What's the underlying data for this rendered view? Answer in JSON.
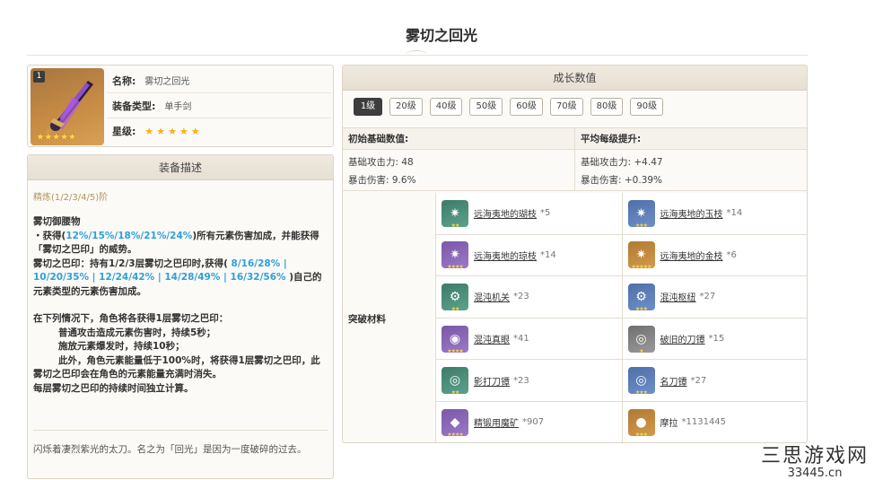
{
  "page": {
    "title": "雾切之回光"
  },
  "info": {
    "refine_badge": "1",
    "name_key": "名称:",
    "name_val": "雾切之回光",
    "type_key": "装备类型:",
    "type_val": "单手剑",
    "star_key": "星级:",
    "stars": "★★★★★",
    "icon_stars": "★★★★★"
  },
  "desc": {
    "header": "装备描述",
    "refine_label": "精炼(1/2/3/4/5)阶",
    "skill_name": "雾切御腰物",
    "line1_a": "・获得(",
    "line1_hl": "12%/15%/18%/21%/24%",
    "line1_b": ")所有元素伤害加成，并能获得「雾切之巴印」的威势。",
    "line2_a": "雾切之巴印：持有1/2/3层雾切之巴印时,获得( ",
    "line2_hl": "8/16/28% | 10/20/35% | 12/24/42% | 14/28/49% | 16/32/56%",
    "line2_b": " )自己的元素类型的元素伤害加成。",
    "line3": "在下列情况下，角色将各获得1层雾切之巴印：",
    "line4": "普通攻击造成元素伤害时，持续5秒；",
    "line5": "施放元素爆发时，持续10秒；",
    "line6": "此外，角色元素能量低于100%时，将获得1层雾切之巴印，此雾切之巴印会在角色的元素能量充满时消失。",
    "line7": "每层雾切之巴印的持续时间独立计算。",
    "lore": "闪烁着凄烈紫光的太刀。名之为「回光」是因为一度破碎的过去。"
  },
  "growth": {
    "header": "成长数值",
    "levels": [
      "1级",
      "20级",
      "40级",
      "50级",
      "60级",
      "70级",
      "80级",
      "90级"
    ],
    "base_head": "初始基础数值:",
    "avg_head": "平均每级提升:",
    "base_atk": "基础攻击力: 48",
    "base_crit": "暴击伤害: 9.6%",
    "avg_atk": "基础攻击力: +4.47",
    "avg_crit": "暴击伤害: +0.39%",
    "mat_label": "突破材料",
    "materials": [
      {
        "name": "远海夷地的瑚枝",
        "count": "*5"
      },
      {
        "name": "远海夷地的玉枝",
        "count": "*14"
      },
      {
        "name": "远海夷地的琼枝",
        "count": "*14"
      },
      {
        "name": "远海夷地的金枝",
        "count": "*6"
      },
      {
        "name": "混沌机关",
        "count": "*23"
      },
      {
        "name": "混沌枢纽",
        "count": "*27"
      },
      {
        "name": "混沌真眼",
        "count": "*41"
      },
      {
        "name": "破旧的刀镡",
        "count": "*15"
      },
      {
        "name": "影打刀镡",
        "count": "*23"
      },
      {
        "name": "名刀镡",
        "count": "*27"
      },
      {
        "name": "精锻用魔矿",
        "count": "*907"
      },
      {
        "name": "摩拉",
        "count": "*1131445"
      }
    ]
  },
  "watermark": {
    "cn": "三思游戏网",
    "url": "33445.cn"
  }
}
